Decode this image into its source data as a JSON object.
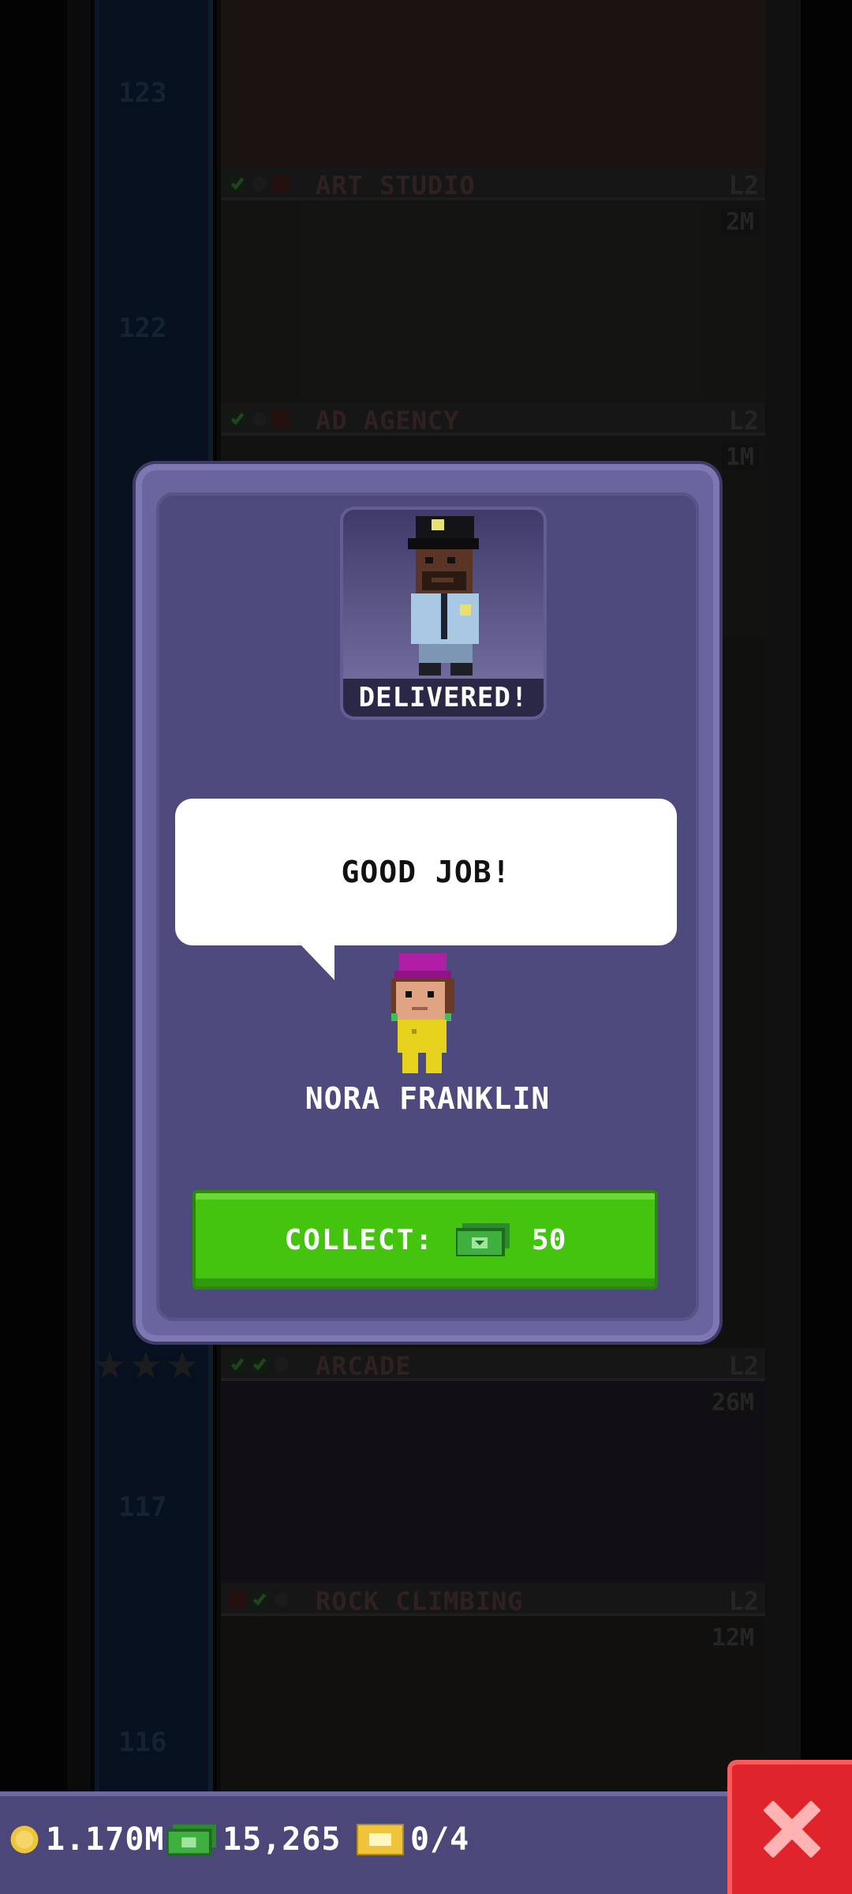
{
  "tower": {
    "floor_numbers": [
      "123",
      "122",
      "117",
      "116"
    ],
    "floors": [
      {
        "name": "ART STUDIO",
        "level": "L2",
        "cost": "2M"
      },
      {
        "name": "AD AGENCY",
        "level": "L2",
        "cost": "1M"
      },
      {
        "name": "ARCADE",
        "level": "L2",
        "cost": "26M"
      },
      {
        "name": "ROCK CLIMBING",
        "level": "L2",
        "cost": "12M"
      }
    ]
  },
  "dialog": {
    "status_label": "DELIVERED!",
    "speech_text": "GOOD JOB!",
    "character_name": "NORA FRANKLIN",
    "collect_label": "COLLECT:",
    "collect_amount": "50"
  },
  "bottom_bar": {
    "coins": "1.170M",
    "bux": "15,265",
    "tickets": "0/4"
  },
  "icons": {
    "coin": "coin-icon",
    "bux": "bux-icon",
    "ticket": "ticket-icon",
    "close": "close-icon"
  },
  "colors": {
    "dialog_bg": "#4f4a7d",
    "collect_green": "#44c40f",
    "close_red": "#e0242c"
  }
}
